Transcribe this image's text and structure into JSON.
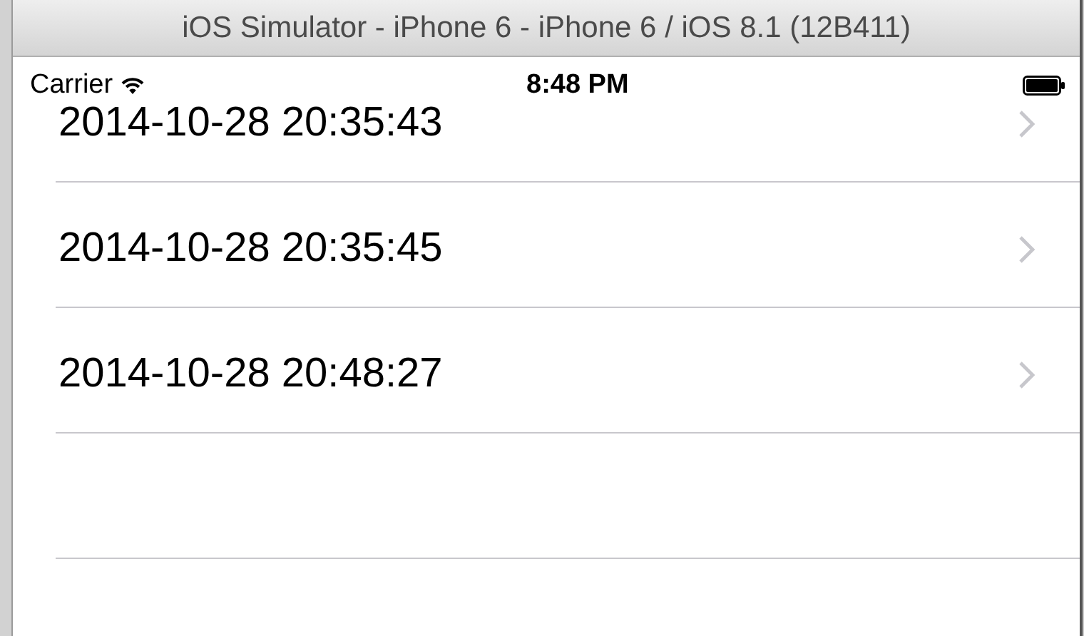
{
  "window": {
    "title": "iOS Simulator - iPhone 6 - iPhone 6 / iOS 8.1 (12B411)"
  },
  "status_bar": {
    "carrier": "Carrier",
    "time": "8:48 PM"
  },
  "rows": [
    {
      "text": "2014-10-28 20:35:43"
    },
    {
      "text": "2014-10-28 20:35:45"
    },
    {
      "text": "2014-10-28 20:48:27"
    }
  ]
}
